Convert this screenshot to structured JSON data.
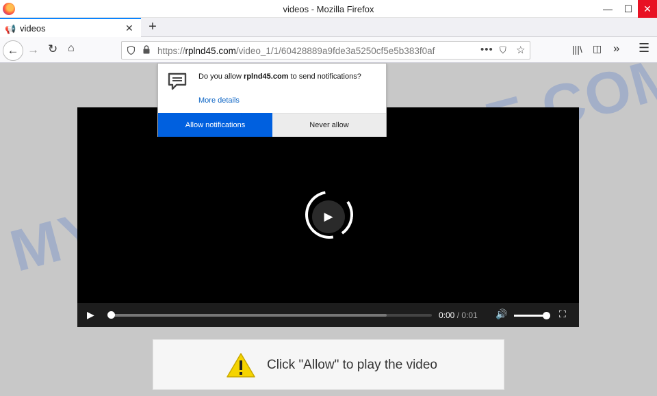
{
  "window": {
    "title": "videos - Mozilla Firefox",
    "minimize_icon": "—",
    "maximize_icon": "☐",
    "close_icon": "✕"
  },
  "tabs": [
    {
      "label": "videos",
      "icon": "megaphone-icon",
      "close": "✕"
    }
  ],
  "newtab_label": "+",
  "nav": {
    "back": "←",
    "forward": "→",
    "reload": "↻",
    "home": "⌂",
    "url_prefix": "https://",
    "url_domain": "rplnd45.com",
    "url_path": "/video_1/1/60428889a9fde3a5250cf5e5b383f0af",
    "page_actions": "•••",
    "pocket": "⛉",
    "star": "☆",
    "library": "|||\\",
    "sidebar": "◫",
    "overflow": "»",
    "menu": "☰"
  },
  "notification": {
    "message_prefix": "Do you allow ",
    "message_domain": "rplnd45.com",
    "message_suffix": " to send notifications?",
    "more_details": "More details",
    "allow_label": "Allow notifications",
    "never_label": "Never allow"
  },
  "video": {
    "current_time": "0:00",
    "separator": "/",
    "duration": "0:01",
    "progress": 0.0,
    "buffered": 0.86,
    "volume": 0.9
  },
  "prompt": {
    "text": "Click \"Allow\" to play the video"
  },
  "watermark": "MYANTISPYWARE.COM",
  "colors": {
    "accent": "#0060df",
    "tab_top": "#0a84ff",
    "close_red": "#e81123",
    "warning_yellow": "#f5d400"
  }
}
